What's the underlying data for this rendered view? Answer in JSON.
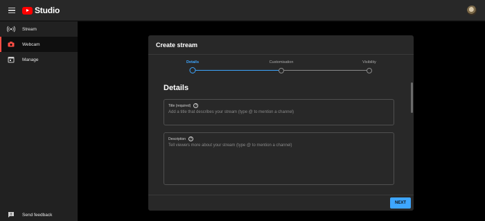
{
  "app": {
    "logo_text": "Studio"
  },
  "sidebar": {
    "items": [
      {
        "label": "Stream",
        "icon": "broadcast-icon"
      },
      {
        "label": "Webcam",
        "icon": "camera-icon",
        "active": true
      },
      {
        "label": "Manage",
        "icon": "calendar-icon"
      }
    ],
    "feedback_label": "Send feedback"
  },
  "dialog": {
    "title": "Create stream",
    "steps": [
      {
        "label": "Details",
        "active": true
      },
      {
        "label": "Customisation",
        "active": false
      },
      {
        "label": "Visibility",
        "active": false
      }
    ],
    "section_title": "Details",
    "title_field": {
      "label": "Title (required)",
      "placeholder": "Add a title that describes your stream (type @ to mention a channel)"
    },
    "description_field": {
      "label": "Description",
      "placeholder": "Tell viewers more about your stream (type @ to mention a channel)"
    },
    "next_label": "NEXT"
  },
  "colors": {
    "accent": "#3ea6ff",
    "brand": "#ff0000",
    "active_nav": "#ff4e45"
  }
}
